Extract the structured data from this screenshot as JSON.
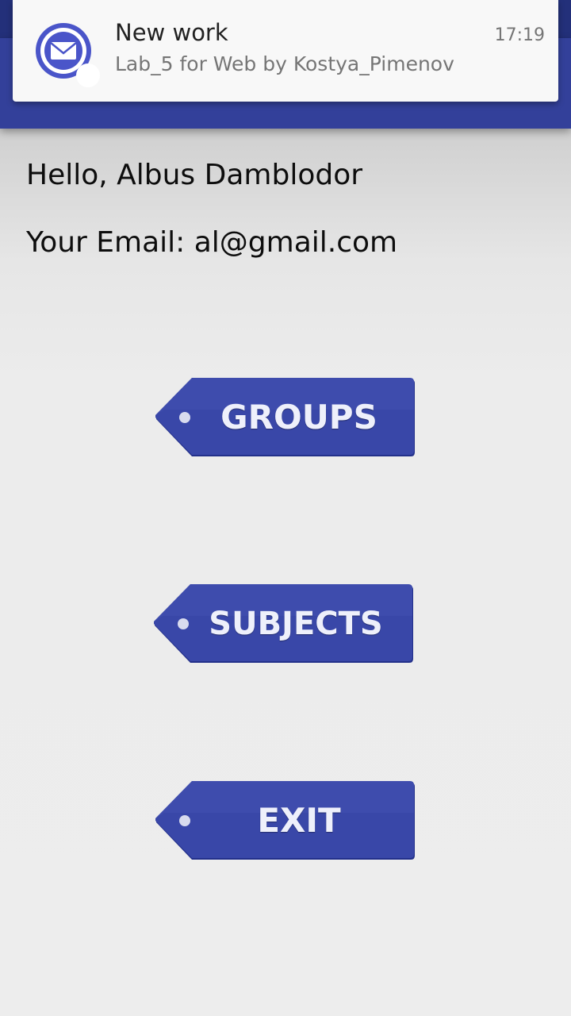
{
  "notification": {
    "title": "New work",
    "body": "Lab_5 for Web by Kostya_Pimenov",
    "time": "17:19",
    "icon": "mail-icon"
  },
  "user": {
    "greeting": "Hello, Albus Damblodor",
    "email_line": "Your Email: al@gmail.com"
  },
  "menu": {
    "groups_label": "GROUPS",
    "subjects_label": "SUBJECTS",
    "exit_label": "EXIT"
  },
  "colors": {
    "app_bar": "#33409a",
    "button": "#3745a5",
    "notification_icon": "#4450c8"
  }
}
